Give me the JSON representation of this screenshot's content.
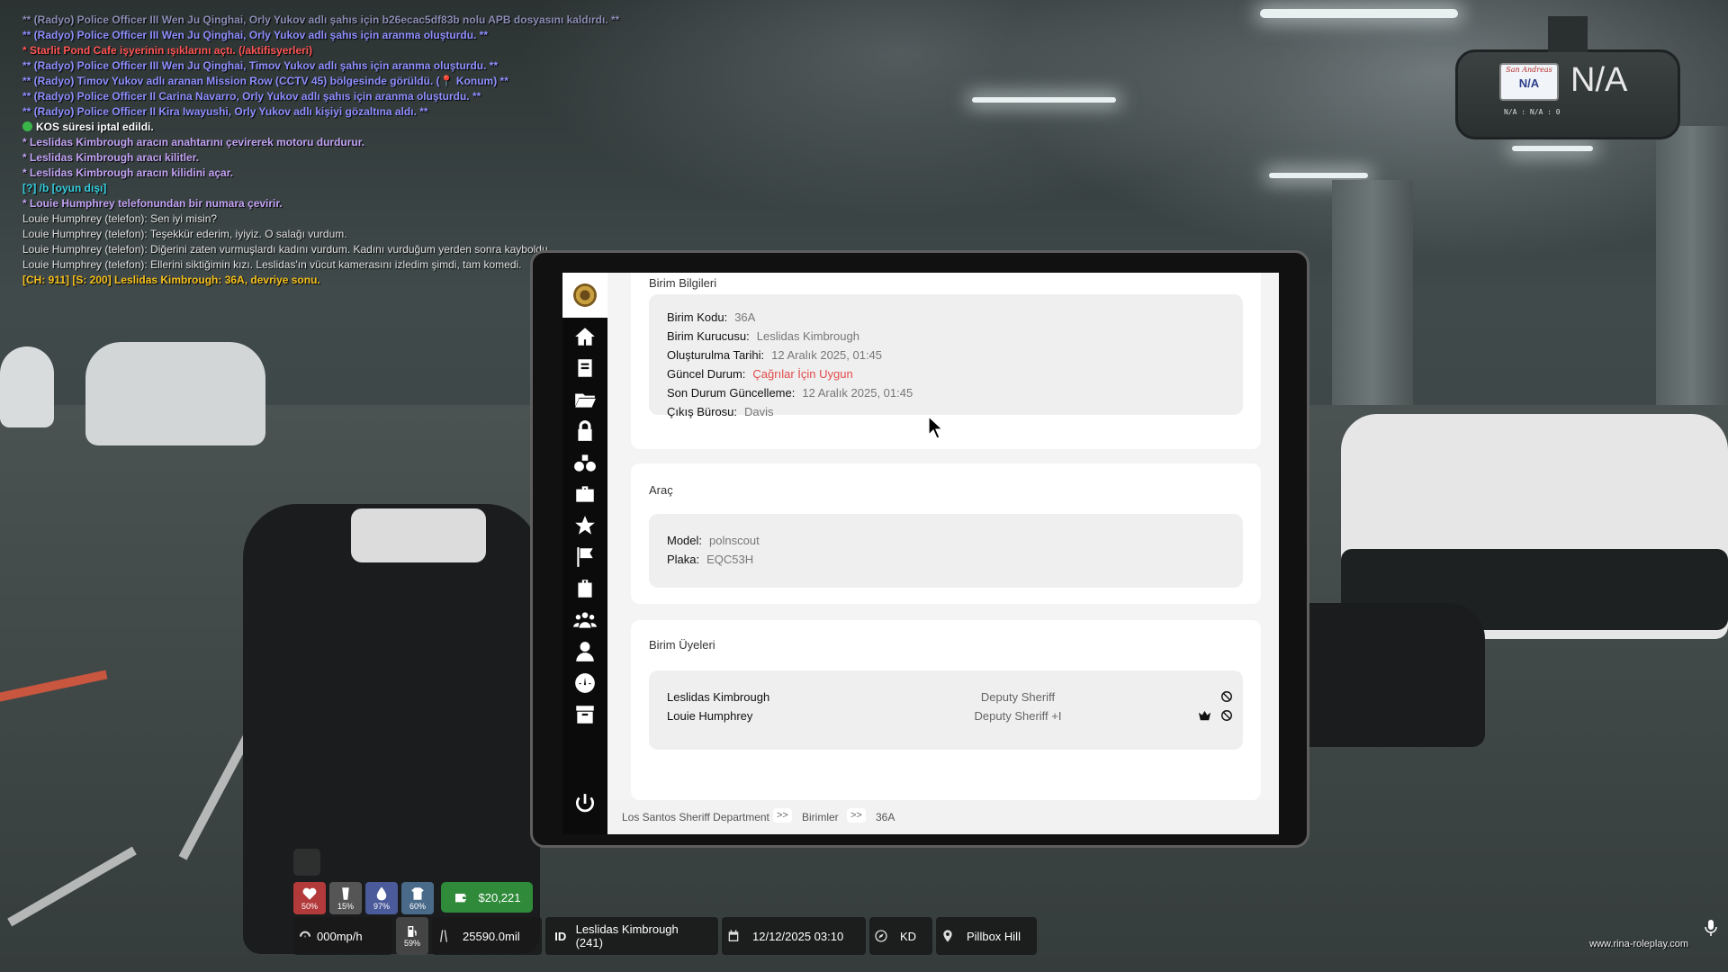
{
  "chat": [
    {
      "text": "** (Radyo) Police Officer III Wen Ju Qinghai, Orly Yukov adlı şahıs için b26ecac5df83b nolu APB dosyasını kaldırdı. **",
      "cls": "c-radio faded"
    },
    {
      "text": "** (Radyo) Police Officer III Wen Ju Qinghai, Orly Yukov adlı şahıs için aranma oluşturdu. **",
      "cls": "c-radio"
    },
    {
      "text": "* Starlit Pond Cafe işyerinin ışıklarını açtı. (/aktifisyerleri)",
      "cls": "c-red"
    },
    {
      "text": "** (Radyo) Police Officer III Wen Ju Qinghai, Timov Yukov adlı şahıs için aranma oluşturdu. **",
      "cls": "c-radio"
    },
    {
      "text": "** (Radyo) Timov Yukov adlı aranan Mission Row (CCTV 45) bölgesinde görüldü. (📍 Konum) **",
      "cls": "c-radio"
    },
    {
      "text": "** (Radyo) Police Officer II Carina Navarro, Orly Yukov adlı şahıs için aranma oluşturdu. **",
      "cls": "c-radio"
    },
    {
      "text": "** (Radyo) Police Officer II Kira Iwayushi, Orly Yukov adlı kişiyi gözaltına aldı. **",
      "cls": "c-radio"
    },
    {
      "text": "KOS süresi iptal edildi.",
      "cls": "c-white",
      "kos": true
    },
    {
      "text": "* Leslidas Kimbrough aracın anahtarını çevirerek motoru durdurur.",
      "cls": "c-me"
    },
    {
      "text": "* Leslidas Kimbrough aracı kilitler.",
      "cls": "c-me"
    },
    {
      "text": "* Leslidas Kimbrough aracın kilidini açar.",
      "cls": "c-me"
    },
    {
      "text": "[?] /b [oyun dışı]",
      "cls": "c-ooc"
    },
    {
      "text": "* Louie Humphrey telefonundan bir numara çevirir.",
      "cls": "c-me"
    },
    {
      "text": "Louie Humphrey (telefon): Sen iyi misin?",
      "cls": "c-phone"
    },
    {
      "text": "Louie Humphrey (telefon): Teşekkür ederim, iyiyiz. O salağı vurdum.",
      "cls": "c-phone"
    },
    {
      "text": "Louie Humphrey (telefon): Diğerini zaten vurmuşlardı kadını vurdum. Kadını vurduğum yerden sonra kayboldu.",
      "cls": "c-phone"
    },
    {
      "text": "Louie Humphrey (telefon): Ellerini siktiğimin kızı. Leslidas'ın vücut kamerasını izledim şimdi, tam komedi.",
      "cls": "c-phone"
    },
    {
      "text": "[CH: 911] [S: 200] Leslidas Kimbrough: 36A, devriye sonu.",
      "cls": "c-yellow"
    }
  ],
  "dashcam": {
    "state": "San Andreas",
    "plate": "N/A",
    "big": "N/A",
    "small": "N/A : N/A : 0"
  },
  "tablet": {
    "unit_info": {
      "title": "Birim Bilgileri",
      "rows": [
        {
          "k": "Birim Kodu:",
          "v": "36A"
        },
        {
          "k": "Birim Kurucusu:",
          "v": "Leslidas Kimbrough"
        },
        {
          "k": "Oluşturulma Tarihi:",
          "v": "12 Aralık 2025, 01:45"
        },
        {
          "k": "Güncel Durum:",
          "v": "Çağrılar İçin Uygun"
        },
        {
          "k": "Son Durum Güncelleme:",
          "v": "12 Aralık 2025, 01:45"
        },
        {
          "k": "Çıkış Bürosu:",
          "v": "Davis"
        }
      ]
    },
    "vehicle": {
      "title": "Araç",
      "rows": [
        {
          "k": "Model:",
          "v": "polnscout"
        },
        {
          "k": "Plaka:",
          "v": "EQC53H"
        }
      ]
    },
    "members": {
      "title": "Birim Üyeleri",
      "list": [
        {
          "name": "Leslidas Kimbrough",
          "rank": "Deputy Sheriff"
        },
        {
          "name": "Louie Humphrey",
          "rank": "Deputy Sheriff +I"
        }
      ]
    },
    "breadcrumb": {
      "a": "Los Santos Sheriff Department",
      "sep": ">>",
      "b": "Birimler",
      "c": "36A"
    },
    "status_color": "#e34a4a"
  },
  "hud": {
    "stats": {
      "health": "50%",
      "hunger": "15%",
      "thirst": "97%",
      "stamina": "60%"
    },
    "money": "$20,221",
    "speed": "000mp/h",
    "fuel": "59%",
    "odometer": "25590.0mil",
    "id_label": "ID",
    "player": "Leslidas Kimbrough (241)",
    "datetime": "12/12/2025 03:10",
    "heading": "KD",
    "location": "Pillbox Hill",
    "website": "www.rina-roleplay.com"
  }
}
